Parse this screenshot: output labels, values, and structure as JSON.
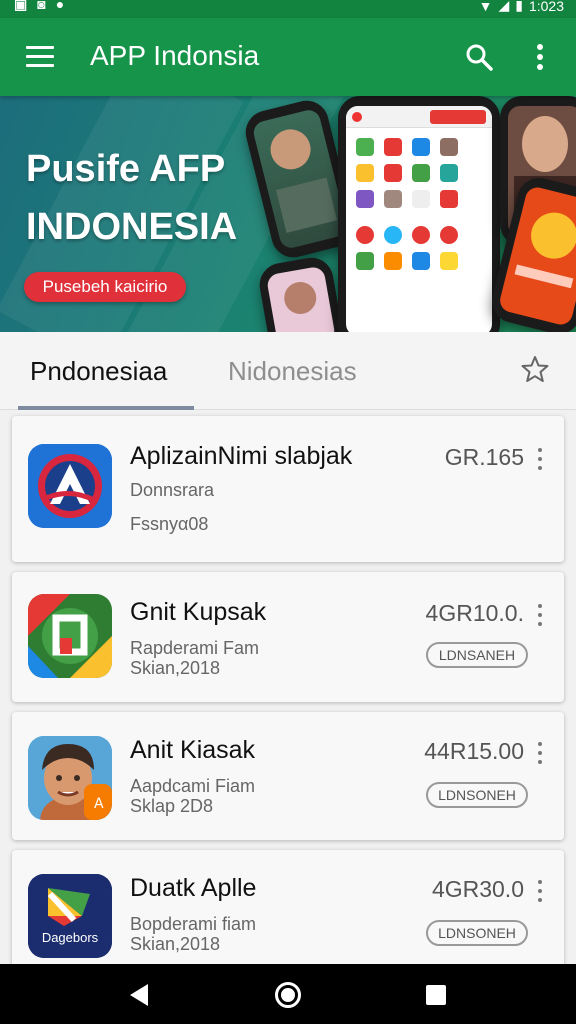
{
  "status_bar": {
    "left_icons": [
      "sim-icon",
      "notification-icon",
      "dot-icon"
    ],
    "time": "1:023"
  },
  "app_bar": {
    "title": "APP Indonsia"
  },
  "banner": {
    "title_line1": "Pusife AFP",
    "title_line2": "INDONESIA",
    "button_label": "Pusebeh kaicirio"
  },
  "tabs": [
    {
      "label": "Pndonesiaa"
    },
    {
      "label": "Nidonesias"
    }
  ],
  "apps": [
    {
      "name": "AplizainNimi slabjak",
      "subtitle1": "Donnsrara",
      "subtitle2": "Fssnyα08",
      "price": "GR.165",
      "icon": "a-letter-icon"
    },
    {
      "name": "Gnit Kupsak",
      "subtitle1": "Rapderami Fam",
      "subtitle2": "Skian,2018",
      "price": "4GR10.0.",
      "badge": "LDNSANEH",
      "icon": "frame-logo-icon"
    },
    {
      "name": "Anit Kiasak",
      "subtitle1": "Aapdcami Fiam",
      "subtitle2": "Sklap 2D8",
      "price": "44R15.00",
      "badge": "LDNSONEH",
      "icon": "avatar-icon"
    },
    {
      "name": "Duatk Aplle",
      "subtitle1": "Bopderami fiam",
      "subtitle2": "Skian,2018",
      "price": "4GR30.0",
      "badge": "LDNSONEH",
      "icon": "play-logo-icon",
      "icon_text": "Dagebors"
    }
  ],
  "colors": {
    "app_bar": "#16944a",
    "status_bar": "#13843f",
    "accent_red": "#e0313b"
  }
}
